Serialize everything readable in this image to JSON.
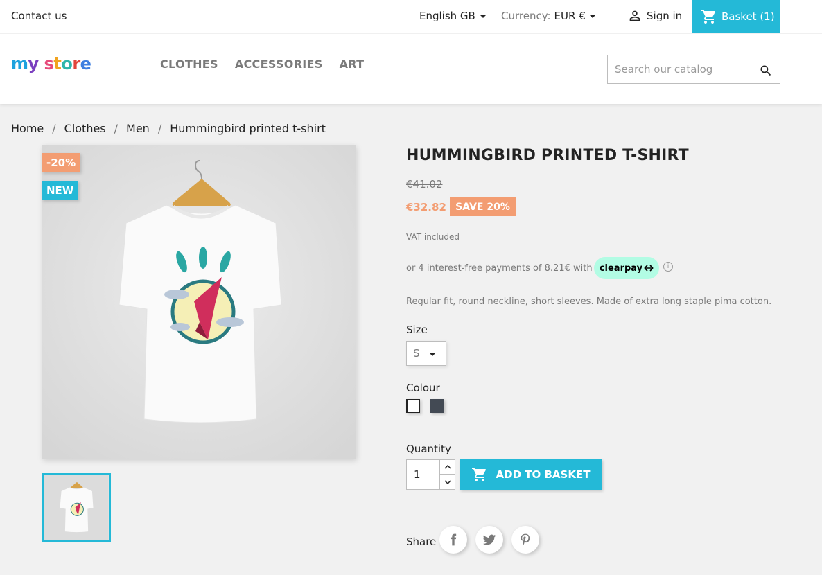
{
  "topbar": {
    "contact": "Contact us",
    "language": "English GB",
    "currency_label": "Currency:",
    "currency_value": "EUR €",
    "sign_in": "Sign in",
    "basket": "Basket (1)"
  },
  "header": {
    "logo": "my store",
    "nav": [
      "CLOTHES",
      "ACCESSORIES",
      "ART"
    ],
    "search_placeholder": "Search our catalog"
  },
  "breadcrumb": [
    "Home",
    "Clothes",
    "Men",
    "Hummingbird printed t-shirt"
  ],
  "product": {
    "flags": {
      "discount": "-20%",
      "new": "NEW"
    },
    "title": "HUMMINGBIRD PRINTED T-SHIRT",
    "old_price": "€41.02",
    "price": "€32.82",
    "save": "SAVE 20%",
    "vat": "VAT included",
    "clearpay_text": "or 4 interest-free payments of 8.21€ with",
    "clearpay_badge": "clearpay",
    "description": "Regular fit, round neckline, short sleeves. Made of extra long staple pima cotton.",
    "size_label": "Size",
    "size_value": "S",
    "colour_label": "Colour",
    "colours": [
      "#ffffff",
      "#434a54"
    ],
    "quantity_label": "Quantity",
    "quantity": "1",
    "add_to_basket": "ADD TO BASKET",
    "share_label": "Share"
  },
  "colors": {
    "accent": "#24b9d7",
    "discount": "#f39d72",
    "clearpay": "#b2fce4"
  }
}
